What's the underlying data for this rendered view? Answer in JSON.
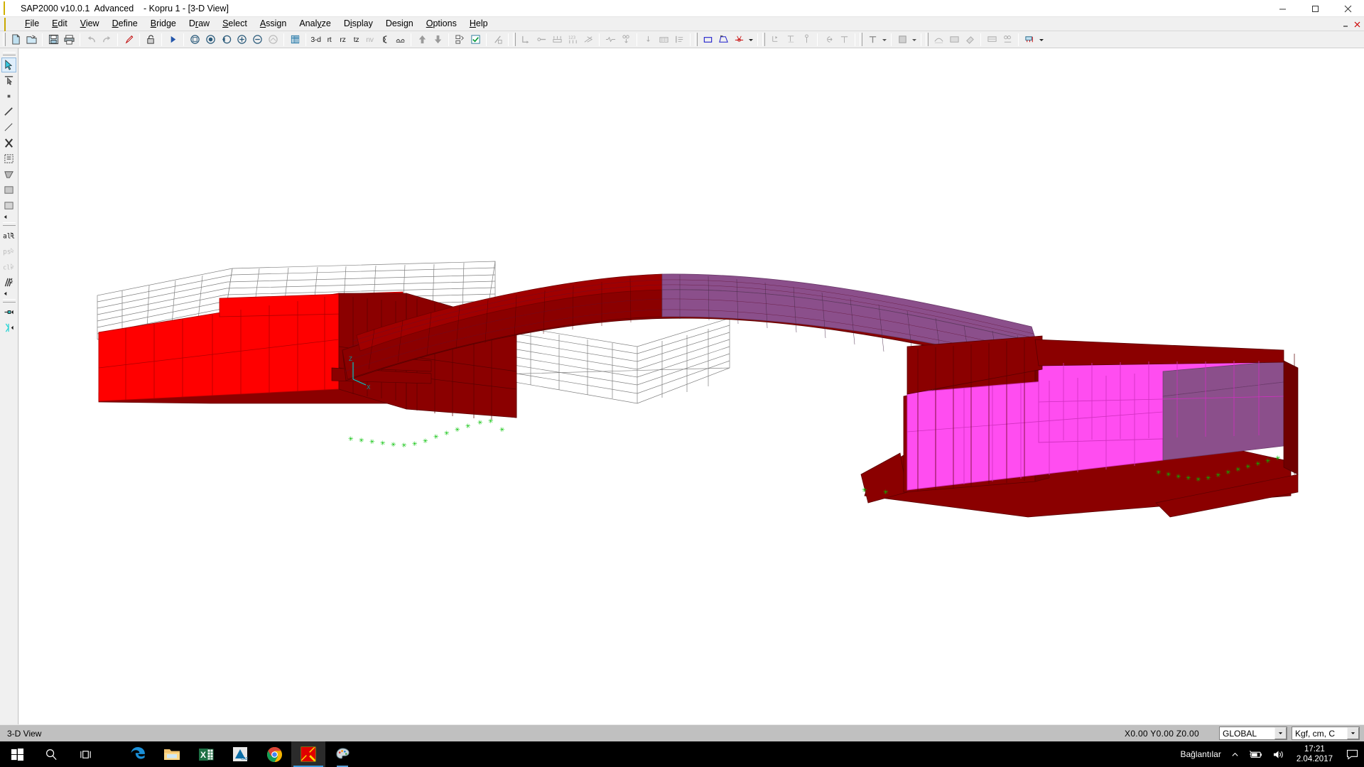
{
  "window": {
    "title": "SAP2000 v10.0.1  Advanced    - Kopru 1 - [3-D View]",
    "app_icon": "sap2000-star-icon",
    "controls": {
      "minimize": "minimize-icon",
      "maximize": "maximize-icon",
      "close": "close-icon"
    }
  },
  "menubar": {
    "mdi_icon": "sap2000-document-icon",
    "items": [
      {
        "label": "File",
        "mnemonic": "F"
      },
      {
        "label": "Edit",
        "mnemonic": "E"
      },
      {
        "label": "View",
        "mnemonic": "V"
      },
      {
        "label": "Define",
        "mnemonic": "D"
      },
      {
        "label": "Bridge",
        "mnemonic": "B"
      },
      {
        "label": "Draw",
        "mnemonic": "r"
      },
      {
        "label": "Select",
        "mnemonic": "S"
      },
      {
        "label": "Assign",
        "mnemonic": "A"
      },
      {
        "label": "Analyze",
        "mnemonic": "z"
      },
      {
        "label": "Display",
        "mnemonic": "i"
      },
      {
        "label": "Design",
        "mnemonic": "g"
      },
      {
        "label": "Options",
        "mnemonic": "O"
      },
      {
        "label": "Help",
        "mnemonic": "H"
      }
    ],
    "mdi_controls": {
      "restore": "mdi-restore-icon",
      "close": "mdi-close-icon"
    }
  },
  "toolbar": {
    "groups": [
      {
        "name": "file-group",
        "buttons": [
          {
            "name": "new-model-button",
            "icon": "new-document-icon",
            "label": "",
            "disabled": false
          },
          {
            "name": "open-file-button",
            "icon": "open-folder-icon",
            "label": "",
            "disabled": false
          }
        ]
      },
      {
        "name": "save-print-group",
        "buttons": [
          {
            "name": "save-button",
            "icon": "floppy-disk-icon",
            "label": "",
            "disabled": false
          },
          {
            "name": "print-button",
            "icon": "printer-icon",
            "label": "",
            "disabled": false
          }
        ]
      },
      {
        "name": "undo-redo-group",
        "buttons": [
          {
            "name": "undo-button",
            "icon": "undo-arrow-icon",
            "label": "",
            "disabled": true
          },
          {
            "name": "redo-button",
            "icon": "redo-arrow-icon",
            "label": "",
            "disabled": true
          }
        ]
      },
      {
        "name": "refresh-group",
        "buttons": [
          {
            "name": "refresh-window-button",
            "icon": "pencil-icon",
            "label": "",
            "disabled": false
          }
        ]
      },
      {
        "name": "lock-group",
        "buttons": [
          {
            "name": "lock-unlock-model-button",
            "icon": "padlock-open-icon",
            "label": "",
            "disabled": false
          }
        ]
      },
      {
        "name": "run-group",
        "buttons": [
          {
            "name": "run-analysis-button",
            "icon": "play-triangle-icon",
            "label": "",
            "disabled": false
          }
        ]
      },
      {
        "name": "zoom-group",
        "buttons": [
          {
            "name": "rubber-band-zoom-button",
            "icon": "rubber-band-zoom-icon",
            "label": "",
            "disabled": false
          },
          {
            "name": "restore-full-view-button",
            "icon": "full-view-icon",
            "label": "",
            "disabled": false
          },
          {
            "name": "previous-zoom-button",
            "icon": "previous-zoom-icon",
            "label": "",
            "disabled": false
          },
          {
            "name": "zoom-in-one-step-button",
            "icon": "zoom-in-icon",
            "label": "",
            "disabled": false
          },
          {
            "name": "zoom-out-one-step-button",
            "icon": "zoom-out-icon",
            "label": "",
            "disabled": false
          },
          {
            "name": "pan-button",
            "icon": "pan-hand-icon",
            "label": "",
            "disabled": true
          }
        ]
      },
      {
        "name": "perspective-group",
        "buttons": [
          {
            "name": "set-display-options-button",
            "icon": "display-options-icon",
            "label": "",
            "disabled": false
          }
        ]
      },
      {
        "name": "view-direction-group",
        "buttons": [
          {
            "name": "view-3d-button",
            "icon": "",
            "label": "3-d",
            "disabled": false
          },
          {
            "name": "view-rt-button",
            "icon": "",
            "label": "rt",
            "disabled": false
          },
          {
            "name": "view-rz-button",
            "icon": "",
            "label": "rz",
            "disabled": false
          },
          {
            "name": "view-tz-button",
            "icon": "",
            "label": "tz",
            "disabled": false
          },
          {
            "name": "view-nv-button",
            "icon": "",
            "label": "nv",
            "disabled": true
          },
          {
            "name": "perspective-toggle-button",
            "icon": "perspective-icon",
            "label": "",
            "disabled": false
          },
          {
            "name": "object-shrink-button",
            "icon": "shrink-objects-icon",
            "label": "",
            "disabled": false
          }
        ]
      },
      {
        "name": "move-group",
        "buttons": [
          {
            "name": "move-up-in-list-button",
            "icon": "arrow-up-icon",
            "label": "",
            "disabled": false
          },
          {
            "name": "move-down-in-list-button",
            "icon": "arrow-down-icon",
            "label": "",
            "disabled": false
          }
        ]
      },
      {
        "name": "select-group",
        "buttons": [
          {
            "name": "set-select-mode-button",
            "icon": "select-mode-icon",
            "label": "",
            "disabled": false
          },
          {
            "name": "assign-check-button",
            "icon": "checkbox-green-icon",
            "label": "",
            "disabled": false
          }
        ]
      },
      {
        "name": "scale-group",
        "buttons": [
          {
            "name": "scale-diagram-button",
            "icon": "scale-diagram-icon",
            "label": "",
            "disabled": true
          }
        ]
      },
      {
        "name": "labels-group",
        "buttons": [
          {
            "name": "show-joint-restraints-button",
            "icon": "joint-restraint-icon",
            "label": "",
            "disabled": true
          },
          {
            "name": "show-frame-releases-button",
            "icon": "frame-release-icon",
            "label": "",
            "disabled": true
          },
          {
            "name": "show-joint-springs-button",
            "icon": "joint-spring-icon",
            "label": "",
            "disabled": true
          },
          {
            "name": "show-labels-button",
            "icon": "numbering-123-icon",
            "label": "",
            "disabled": true
          },
          {
            "name": "show-local-axes-button",
            "icon": "local-axes-icon",
            "label": "",
            "disabled": true
          }
        ]
      },
      {
        "name": "loads-group",
        "buttons": [
          {
            "name": "show-misc-assigns-button",
            "icon": "misc-assign-icon",
            "label": "",
            "disabled": true
          },
          {
            "name": "show-joint-loads-button",
            "icon": "joint-loads-icon",
            "label": "",
            "disabled": true
          }
        ]
      },
      {
        "name": "deformed-group",
        "buttons": [
          {
            "name": "show-undeformed-shape-button",
            "icon": "undeformed-shape-icon",
            "label": "",
            "disabled": true
          },
          {
            "name": "show-deformed-shape-button",
            "icon": "deformed-shape-icon",
            "label": "",
            "disabled": true
          },
          {
            "name": "show-forces-stresses-button",
            "icon": "forces-stresses-icon",
            "label": "",
            "disabled": true
          }
        ]
      },
      {
        "name": "draw-group",
        "buttons": [
          {
            "name": "draw-quad-area-button",
            "icon": "draw-rectangle-icon",
            "label": "",
            "disabled": false
          },
          {
            "name": "draw-frame-cable-button",
            "icon": "draw-frame-icon",
            "label": "",
            "disabled": false
          },
          {
            "name": "draw-special-joint-button",
            "icon": "draw-special-joint-icon",
            "label": "",
            "disabled": false
          },
          {
            "name": "draw-dropdown-button",
            "icon": "chevron-down-icon",
            "label": "",
            "disabled": false
          }
        ]
      },
      {
        "name": "assign-group",
        "buttons": [
          {
            "name": "assign-joint-restraint-button",
            "icon": "assign-restraint-icon",
            "label": "",
            "disabled": true
          },
          {
            "name": "assign-joint-pattern-button",
            "icon": "assign-pattern-icon",
            "label": "",
            "disabled": true
          },
          {
            "name": "assign-joint-load-button",
            "icon": "assign-joint-load-icon",
            "label": "",
            "disabled": true
          }
        ]
      },
      {
        "name": "constraint-group",
        "buttons": [
          {
            "name": "assign-frame-load-button",
            "icon": "assign-frame-load-icon",
            "label": "",
            "disabled": true
          },
          {
            "name": "assign-area-load-button",
            "icon": "assign-area-load-icon",
            "label": "",
            "disabled": true
          }
        ]
      },
      {
        "name": "text-group",
        "buttons": [
          {
            "name": "display-text-button",
            "icon": "text-T-icon",
            "label": "",
            "disabled": true
          },
          {
            "name": "display-text-dropdown",
            "icon": "chevron-down-icon",
            "label": "",
            "disabled": true
          }
        ]
      },
      {
        "name": "fill-group",
        "buttons": [
          {
            "name": "display-fill-button",
            "icon": "fill-pattern-icon",
            "label": "",
            "disabled": true
          },
          {
            "name": "display-fill-dropdown",
            "icon": "chevron-down-icon",
            "label": "",
            "disabled": true
          }
        ]
      },
      {
        "name": "bridge-group",
        "buttons": [
          {
            "name": "bridge-layout-line-button",
            "icon": "bridge-layout-icon",
            "label": "",
            "disabled": true
          },
          {
            "name": "bridge-section-button",
            "icon": "bridge-section-icon",
            "label": "",
            "disabled": true
          },
          {
            "name": "bridge-update-button",
            "icon": "bridge-update-icon",
            "label": "",
            "disabled": true
          }
        ]
      },
      {
        "name": "bridge-results-group",
        "buttons": [
          {
            "name": "bridge-response-button",
            "icon": "bridge-response-icon",
            "label": "",
            "disabled": true
          },
          {
            "name": "bridge-influence-button",
            "icon": "bridge-influence-icon",
            "label": "",
            "disabled": true
          }
        ]
      },
      {
        "name": "bridge-load-group",
        "buttons": [
          {
            "name": "bridge-vehicle-load-button",
            "icon": "bridge-vehicle-icon",
            "label": "",
            "disabled": false
          },
          {
            "name": "bridge-load-dropdown",
            "icon": "chevron-down-icon",
            "label": "",
            "disabled": false
          }
        ]
      }
    ]
  },
  "sidebar": {
    "groups": [
      {
        "name": "select-tools",
        "buttons": [
          {
            "name": "pointer-select-tool",
            "icon": "arrow-pointer-icon",
            "selected": true,
            "disabled": false
          },
          {
            "name": "reshape-element-tool",
            "icon": "reshape-arrow-icon",
            "selected": false,
            "disabled": false
          },
          {
            "name": "select-point-tool",
            "icon": "point-square-icon",
            "selected": false,
            "disabled": false
          },
          {
            "name": "select-line-tool",
            "icon": "line-diagonal-icon",
            "selected": false,
            "disabled": false
          },
          {
            "name": "select-intersecting-line-tool",
            "icon": "line-thin-icon",
            "selected": false,
            "disabled": false
          },
          {
            "name": "select-crossing-tool",
            "icon": "crossing-x-icon",
            "selected": false,
            "disabled": false
          },
          {
            "name": "select-window-tool",
            "icon": "window-select-icon",
            "selected": false,
            "disabled": false
          },
          {
            "name": "select-polygon-tool",
            "icon": "polygon-select-icon",
            "selected": false,
            "disabled": false
          },
          {
            "name": "select-area-tool-1",
            "icon": "area-hatch-icon",
            "selected": false,
            "disabled": false
          },
          {
            "name": "select-area-tool-2",
            "icon": "area-hatch2-icon",
            "selected": false,
            "disabled": false
          }
        ]
      },
      {
        "name": "select-all-tools",
        "buttons": [
          {
            "name": "select-all-button",
            "icon": "all-label-icon",
            "label": "all",
            "selected": false,
            "disabled": false
          },
          {
            "name": "select-previous-button",
            "icon": "ps-label-icon",
            "label": "ps",
            "selected": false,
            "disabled": true
          },
          {
            "name": "clear-selection-button",
            "icon": "clr-label-icon",
            "label": "clr",
            "selected": false,
            "disabled": true
          },
          {
            "name": "deselect-tool",
            "icon": "deselect-hatch-icon",
            "selected": false,
            "disabled": false
          }
        ]
      },
      {
        "name": "snap-tools",
        "buttons": [
          {
            "name": "snap-to-point-button",
            "icon": "snap-point-icon",
            "selected": false,
            "disabled": false
          },
          {
            "name": "snap-to-joint-button",
            "icon": "snap-joint-icon",
            "selected": false,
            "disabled": false
          }
        ]
      }
    ]
  },
  "statusbar": {
    "view_label": "3-D View",
    "coordinates": "X0.00  Y0.00  Z0.00",
    "coord_system": "GLOBAL",
    "units": "Kgf, cm, C",
    "coord_system_options": [
      "GLOBAL"
    ],
    "units_options": [
      "Kgf, cm, C"
    ]
  },
  "taskbar": {
    "items": [
      {
        "name": "start-button",
        "icon": "windows-logo-icon"
      },
      {
        "name": "search-button",
        "icon": "search-magnifier-icon"
      },
      {
        "name": "task-view-button",
        "icon": "task-view-icon"
      },
      {
        "name": "edge-button",
        "icon": "edge-browser-icon"
      },
      {
        "name": "file-explorer-button",
        "icon": "folder-explorer-icon"
      },
      {
        "name": "excel-button",
        "icon": "excel-icon"
      },
      {
        "name": "autocad-button",
        "icon": "autocad-icon"
      },
      {
        "name": "chrome-button",
        "icon": "chrome-icon"
      },
      {
        "name": "sap2000-button",
        "icon": "sap2000-star-icon"
      },
      {
        "name": "paint-button",
        "icon": "paint-palette-icon"
      }
    ],
    "tray": {
      "network_label": "Bağlantılar",
      "chevron": "chevron-up-icon",
      "battery": "battery-icon",
      "volume": "speaker-icon",
      "time": "17:21",
      "date": "2.04.2017",
      "notifications": "notification-icon"
    }
  },
  "model": {
    "title": "Kopru 1 bridge 3-D view",
    "colors": {
      "deck_red_bright": "#ff0000",
      "deck_dark_red": "#8b0000",
      "deck_purple": "#8b4f8b",
      "deck_magenta": "#ff4df0",
      "grid_line": "#808080",
      "joint_green": "#00c000"
    }
  }
}
